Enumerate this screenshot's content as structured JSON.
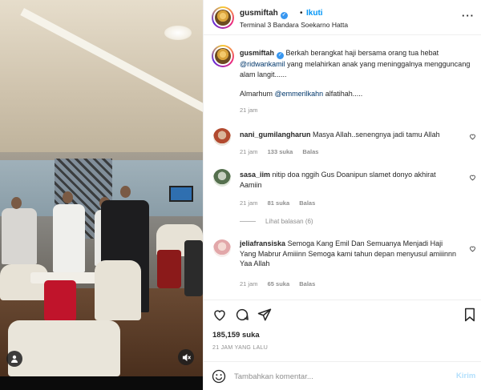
{
  "post": {
    "username": "gusmiftah",
    "follow_label": "Ikuti",
    "separator": "•",
    "location": "Terminal 3 Bandara Soekarno Hatta",
    "more_label": "···"
  },
  "caption": {
    "username": "gusmiftah",
    "text_1": "Berkah berangkat haji bersama orang tua hebat",
    "mention_1": "@ridwankamil",
    "text_2": "yang melahirkan anak yang meninggalnya mengguncang alam langit......",
    "text_3": "Almarhum",
    "mention_2": "@emmerilkahn",
    "text_4": "alfatihah.....",
    "time": "21 jam"
  },
  "comments": [
    {
      "username": "nani_gumilangharun",
      "text": "Masya Allah..senengnya jadi tamu Allah",
      "time": "21 jam",
      "likes": "133 suka",
      "reply_label": "Balas"
    },
    {
      "username": "sasa_iim",
      "text": "nitip doa nggih Gus Doanipun slamet donyo akhirat Aamiin",
      "time": "21 jam",
      "likes": "81 suka",
      "reply_label": "Balas",
      "view_replies": "Lihat balasan (6)"
    },
    {
      "username": "jeliafransiska",
      "text": "Semoga Kang Emil Dan Semuanya Menjadi Haji Yang Mabrur Amiiinn Semoga kami tahun depan menyusul amiiinnn Yaa Allah",
      "time": "21 jam",
      "likes": "65 suka",
      "reply_label": "Balas"
    }
  ],
  "stats": {
    "likes": "185,159 suka",
    "time_ago": "21 JAM YANG LALU"
  },
  "composer": {
    "placeholder": "Tambahkan komentar...",
    "post_label": "Kirim"
  },
  "icons": {
    "like": "heart-icon",
    "comment": "comment-icon",
    "share": "share-icon",
    "save": "bookmark-icon",
    "emoji": "emoji-icon",
    "mute": "volume-off-icon",
    "tag": "user-tag-icon",
    "verified": "verified-badge-icon"
  },
  "colors": {
    "link": "#00376b",
    "accent": "#0095f6",
    "verified": "#3897f0",
    "post_disabled": "#b2dffc"
  }
}
